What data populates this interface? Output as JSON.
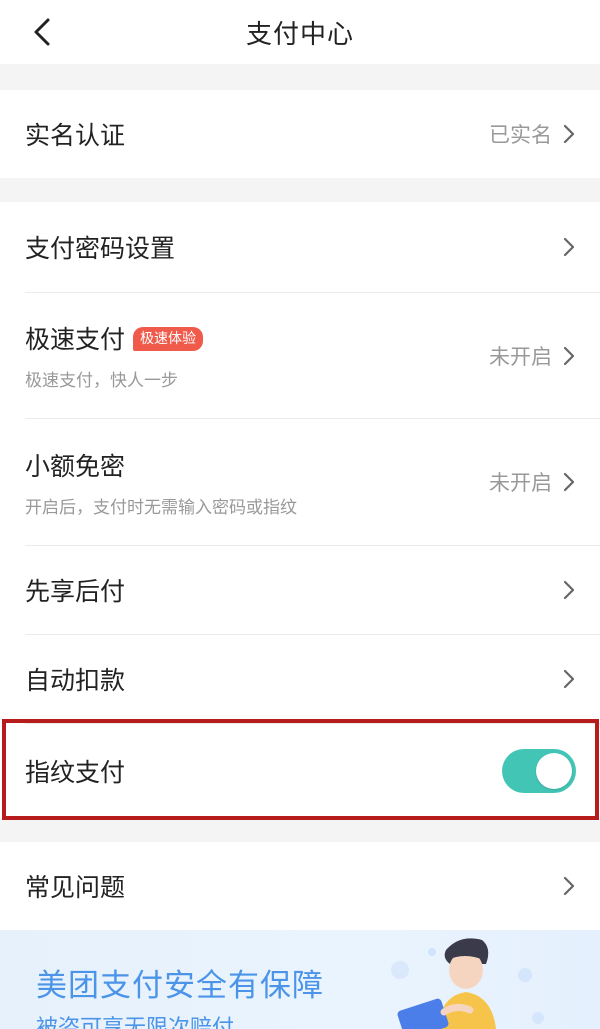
{
  "header": {
    "title": "支付中心"
  },
  "sections": {
    "verification": {
      "label": "实名认证",
      "value": "已实名"
    },
    "password": {
      "label": "支付密码设置"
    },
    "quick_pay": {
      "label": "极速支付",
      "badge": "极速体验",
      "sub": "极速支付，快人一步",
      "value": "未开启"
    },
    "small_free": {
      "label": "小额免密",
      "sub": "开启后，支付时无需输入密码或指纹",
      "value": "未开启"
    },
    "pay_later": {
      "label": "先享后付"
    },
    "auto_debit": {
      "label": "自动扣款"
    },
    "fingerprint": {
      "label": "指纹支付",
      "enabled": true
    },
    "faq": {
      "label": "常见问题"
    }
  },
  "banner": {
    "title": "美团支付安全有保障",
    "subtitle": "被盗可享无限次赔付"
  },
  "colors": {
    "toggle_on": "#43c5b6",
    "badge": "#f05a4b",
    "highlight": "#b71c1c",
    "banner_text": "#4b94e8"
  },
  "icons": {
    "back": "chevron-left-icon",
    "arrow": "chevron-right-icon"
  }
}
